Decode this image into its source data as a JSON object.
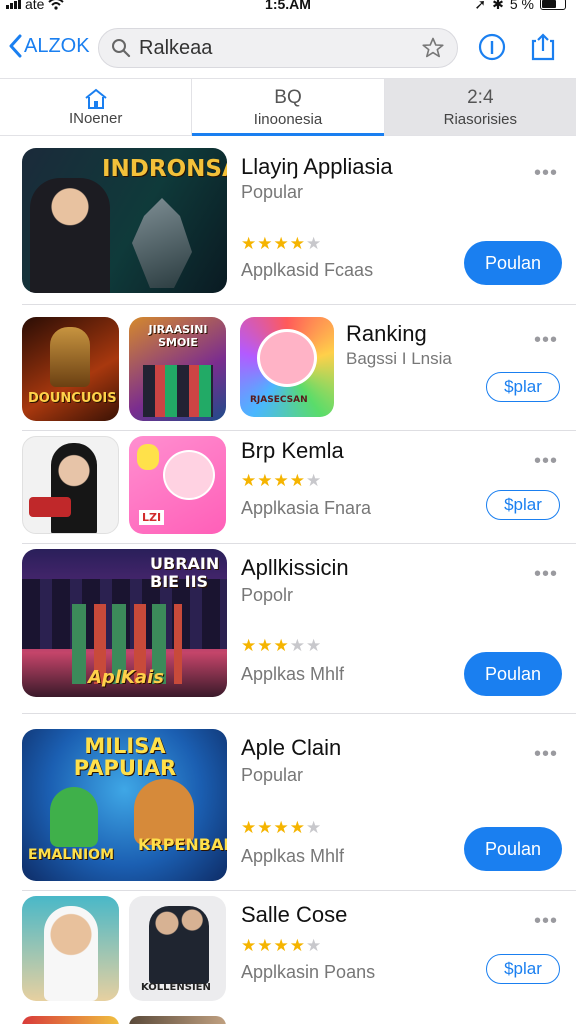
{
  "status": {
    "carrier": "ate",
    "time": "1:5.AM",
    "battery": "5 %"
  },
  "nav": {
    "back_label": "ALZOK",
    "search_value": "Ralkeaa"
  },
  "tabs": [
    {
      "text": "",
      "label": "INoener",
      "icon": "home-icon"
    },
    {
      "text": "BQ",
      "label": "Iinoonesia",
      "icon": ""
    },
    {
      "text": "2:4",
      "label": "Riasorisies",
      "icon": ""
    }
  ],
  "rows": [
    {
      "title": "Llayiŋ Appliasia",
      "subtitle": "Popular",
      "rating": 4,
      "caption": "Applkasid Fcaas",
      "button": "Poulan",
      "art_text": "INDRONSAN"
    },
    {
      "title": "Ranking",
      "subtitle": "Bagssi I Lnsia",
      "rating": 0,
      "caption": "",
      "button": "$plar",
      "art_text": [
        "DOUNCUOIS",
        "JIRAASINI SMOIE",
        "RJASECSAN"
      ]
    },
    {
      "title": "Brp Kemla",
      "subtitle": "",
      "rating": 4,
      "caption": "Applkasia Fnara",
      "button": "$plar",
      "art_text": [
        "",
        "LZI"
      ]
    },
    {
      "title": "Apllkissicin",
      "subtitle": "Popolr",
      "rating": 3,
      "caption": "Applkas Mhlf",
      "button": "Poulan",
      "art_text": [
        "UBRAIN BIE IIS",
        "AplKais"
      ]
    },
    {
      "title": "Aple Clain",
      "subtitle": "Popular",
      "rating": 4,
      "caption": "Applkas Mhlf",
      "button": "Poulan",
      "art_text": [
        "MILISA PAPUIAR",
        "EMALNIOM",
        "KRPENBAI"
      ]
    },
    {
      "title": "Salle Cose",
      "subtitle": "",
      "rating": 4,
      "caption": "Applkasin Poans",
      "button": "$plar",
      "art_text": [
        "",
        "KOLLENSIEN"
      ]
    }
  ],
  "colors": {
    "accent": "#1a7ff0",
    "star": "#f5b400"
  }
}
